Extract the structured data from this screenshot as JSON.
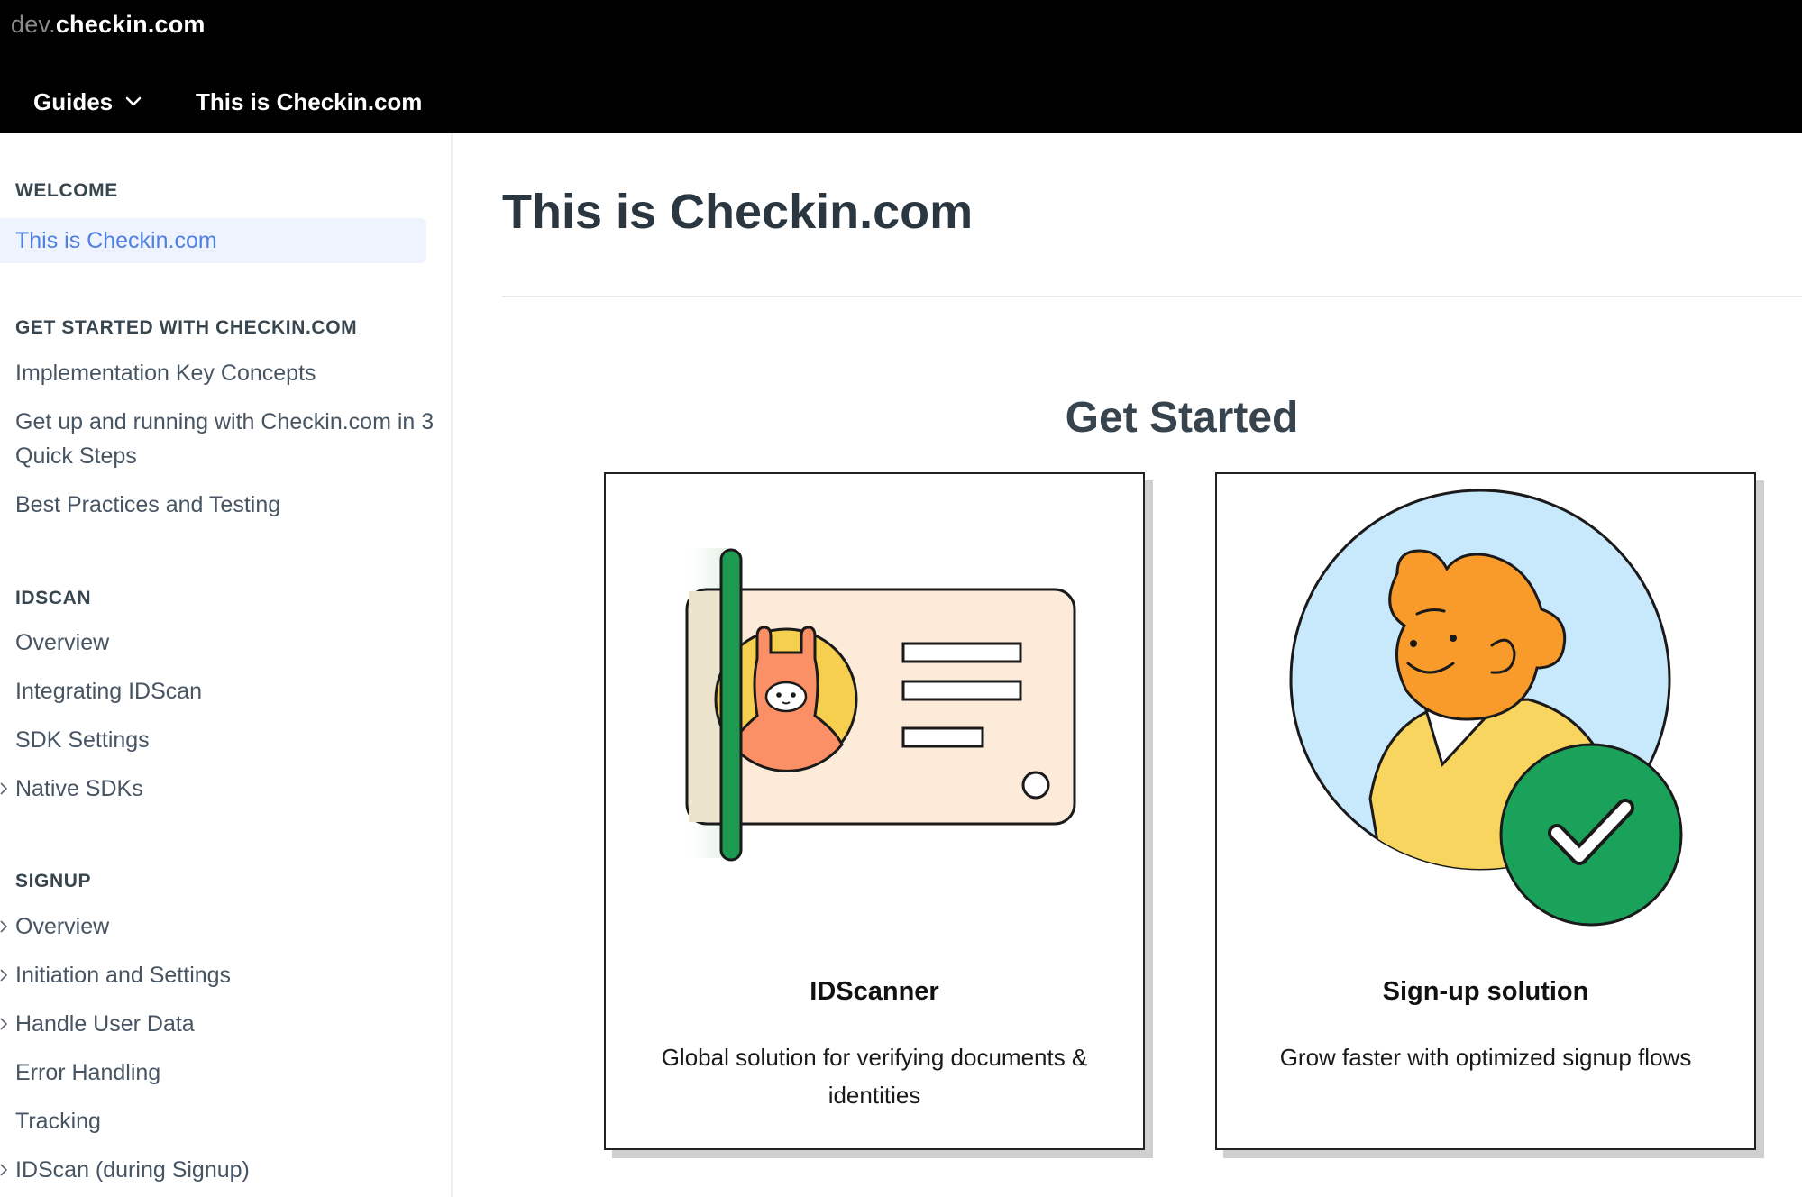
{
  "topbar": {
    "brand_prefix": "dev.",
    "brand_name": "checkin.com",
    "nav_guides": "Guides",
    "nav_current": "This is Checkin.com"
  },
  "sidebar": {
    "sections": [
      {
        "title": "WELCOME",
        "items": [
          {
            "label": "This is Checkin.com",
            "active": true
          }
        ]
      },
      {
        "title": "GET STARTED WITH CHECKIN.COM",
        "items": [
          {
            "label": "Implementation Key Concepts"
          },
          {
            "label": "Get up and running with Checkin.com in 3 Quick Steps"
          },
          {
            "label": "Best Practices and Testing"
          }
        ]
      },
      {
        "title": "IDSCAN",
        "items": [
          {
            "label": "Overview"
          },
          {
            "label": "Integrating IDScan"
          },
          {
            "label": "SDK Settings"
          },
          {
            "label": "Native SDKs",
            "expandable": true
          }
        ]
      },
      {
        "title": "SIGNUP",
        "items": [
          {
            "label": "Overview",
            "expandable": true
          },
          {
            "label": "Initiation and Settings",
            "expandable": true
          },
          {
            "label": "Handle User Data",
            "expandable": true
          },
          {
            "label": "Error Handling"
          },
          {
            "label": "Tracking"
          },
          {
            "label": "IDScan (during Signup)",
            "expandable": true
          }
        ]
      }
    ]
  },
  "main": {
    "title": "This is Checkin.com",
    "get_started": "Get Started",
    "cards": [
      {
        "title": "IDScanner",
        "description": "Global solution for verifying documents & identities"
      },
      {
        "title": "Sign-up solution",
        "description": "Grow faster with optimized signup flows"
      }
    ]
  },
  "colors": {
    "topbar_bg": "#000000",
    "active_link": "#4f7fe0",
    "active_bg": "#eef3fd",
    "scanner_green": "#1b9a50",
    "check_green": "#1aa25b",
    "face_orange": "#f99b2a",
    "circle_blue": "#c8e8fb",
    "sweater_yellow": "#f8d55f"
  }
}
